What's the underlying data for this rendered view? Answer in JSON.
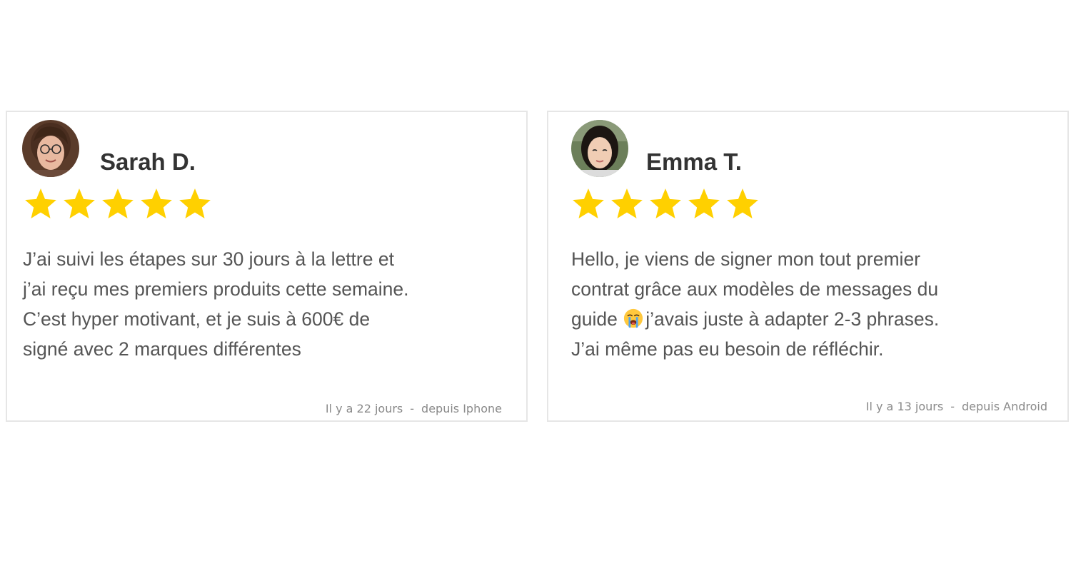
{
  "reviews": [
    {
      "name": "Sarah D.",
      "rating": 5,
      "lines": [
        "J’ai suivi les étapes sur 30 jours à la lettre et",
        "j’ai reçu mes premiers produits cette semaine.",
        "C’est hyper motivant, et je suis à 600€ de",
        "signé avec 2 marques différentes"
      ],
      "time": "Il y a 22 jours",
      "separator": "-",
      "source": "depuis Iphone"
    },
    {
      "name": "Emma T.",
      "rating": 5,
      "lines": [
        "Hello, je viens de signer mon tout premier",
        "contrat grâce aux modèles de messages du",
        "guide",
        "j’avais juste à adapter 2-3 phrases.",
        "J’ai même pas eu besoin de réfléchir."
      ],
      "emoji": "crying-face",
      "time": "Il y a 13 jours",
      "separator": "-",
      "source": "depuis Android"
    }
  ],
  "colors": {
    "star": "#FFD000",
    "border": "#e6e6e6",
    "name": "#333333",
    "text": "#555555",
    "meta": "#8a8a8a"
  }
}
